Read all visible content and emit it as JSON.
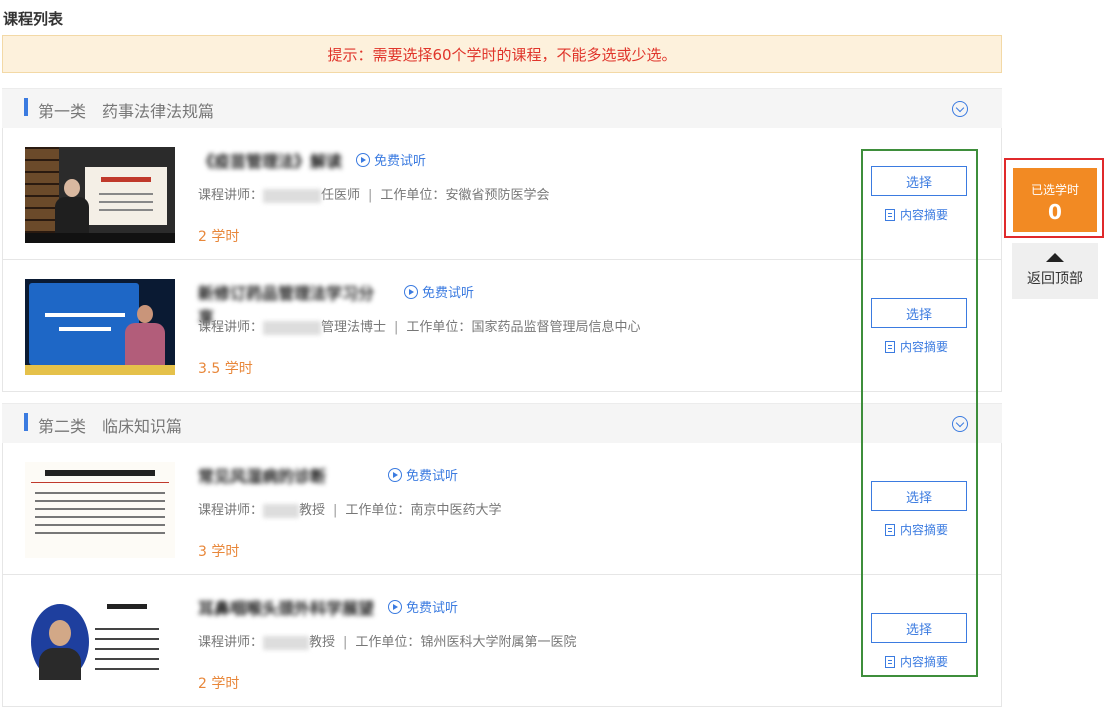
{
  "page": {
    "title": "课程列表"
  },
  "notice": {
    "text": "提示：需要选择60个学时的课程，不能多选或少选。"
  },
  "categories": [
    {
      "title": "第一类　药事法律法规篇"
    },
    {
      "title": "第二类　临床知识篇"
    }
  ],
  "courses": [
    {
      "title": "《疫苗管理法》解读",
      "free_label": "免费试听",
      "teacher_label": "课程讲师：",
      "teacher_title": "任医师",
      "unit_label": "工作单位：",
      "unit": "安徽省预防医学会",
      "hours": "2 学时",
      "select_label": "选择",
      "summary_label": "内容摘要"
    },
    {
      "title": "新修订药品管理法学习分享",
      "free_label": "免费试听",
      "teacher_label": "课程讲师：",
      "teacher_title": "管理法博士",
      "unit_label": "工作单位：",
      "unit": "国家药品监督管理局信息中心",
      "hours": "3.5 学时",
      "select_label": "选择",
      "summary_label": "内容摘要"
    },
    {
      "title": "常见风湿病的诊断",
      "free_label": "免费试听",
      "teacher_label": "课程讲师：",
      "teacher_title": "教授",
      "unit_label": "工作单位：",
      "unit": "南京中医药大学",
      "hours": "3 学时",
      "select_label": "选择",
      "summary_label": "内容摘要"
    },
    {
      "title": "耳鼻咽喉头颈外科学展望",
      "free_label": "免费试听",
      "teacher_label": "课程讲师：",
      "teacher_title": "教授",
      "unit_label": "工作单位：",
      "unit": "锦州医科大学附属第一医院",
      "hours": "2 学时",
      "select_label": "选择",
      "summary_label": "内容摘要"
    }
  ],
  "sidebar": {
    "selected_label": "已选学时",
    "selected_count": "0",
    "back_top_label": "返回顶部"
  },
  "colors": {
    "accent_blue": "#3b7be0",
    "hours_orange": "#e8873a",
    "notice_red": "#e0352b",
    "selected_box": "#f28a23"
  }
}
